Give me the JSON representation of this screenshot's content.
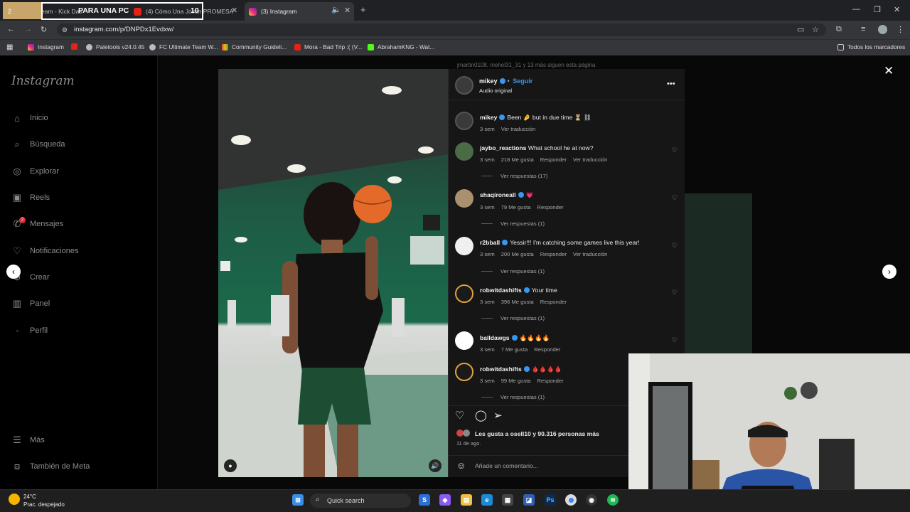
{
  "browser": {
    "tabs": [
      {
        "label": "eam - Kick Das"
      },
      {
        "label": "(4) Cómo Una Joven PROMESA"
      },
      {
        "label": "(3) Instagram",
        "active": true
      }
    ],
    "overlay": {
      "num_left": "2",
      "text": "PARA UNA PC",
      "num_right": "10"
    },
    "url": "instagram.com/p/DNPDx1Evdxw/",
    "bookmarks": [
      "Instagram",
      "Paletools v24.0.45",
      "FC Ultimate Team W...",
      "Community Guideli...",
      "Mora - Bad Trip :( (V...",
      "AbrahamKNG - Wat..."
    ],
    "all_bookmarks": "Todos los marcadores"
  },
  "sidebar": {
    "brand": "Instagram",
    "items": [
      {
        "label": "Inicio",
        "icon": "home-icon"
      },
      {
        "label": "Búsqueda",
        "icon": "search-icon"
      },
      {
        "label": "Explorar",
        "icon": "compass-icon"
      },
      {
        "label": "Reels",
        "icon": "reels-icon"
      },
      {
        "label": "Mensajes",
        "icon": "messenger-icon"
      },
      {
        "label": "Notificaciones",
        "icon": "heart-icon"
      },
      {
        "label": "Crear",
        "icon": "plus-icon"
      },
      {
        "label": "Panel",
        "icon": "panel-icon"
      },
      {
        "label": "Perfil",
        "icon": "avatar-icon"
      }
    ],
    "more": "Más",
    "meta": "También de Meta",
    "messages_badge": "2"
  },
  "background": {
    "suggestion": "jmartin0108, mehel31_31 y 13 más siguen esta página"
  },
  "post": {
    "author": "mikey",
    "follow": "Seguir",
    "audio": "Audio original",
    "caption": {
      "text": "Been 🤌 but in due time ⏳ ⛓",
      "time": "3 sem",
      "translate": "Ver traducción"
    },
    "comments": [
      {
        "user": "jaybo_reactions",
        "verified": false,
        "text": "What school he at now?",
        "time": "3 sem",
        "likes": "218 Me gusta",
        "reply": "Responder",
        "translate": "Ver traducción",
        "replies": "Ver respuestas (17)"
      },
      {
        "user": "shaqironeall",
        "verified": true,
        "text": "💗",
        "time": "3 sem",
        "likes": "79 Me gusta",
        "reply": "Responder",
        "translate": "",
        "replies": "Ver respuestas (1)"
      },
      {
        "user": "r2bball",
        "verified": true,
        "text": "Yessir!!! I'm catching some games live this year!",
        "time": "3 sem",
        "likes": "200 Me gusta",
        "reply": "Responder",
        "translate": "Ver traducción",
        "replies": "Ver respuestas (1)"
      },
      {
        "user": "robwitdashifts",
        "verified": true,
        "text": "Your time",
        "time": "3 sem",
        "likes": "396 Me gusta",
        "reply": "Responder",
        "translate": "",
        "replies": "Ver respuestas (1)"
      },
      {
        "user": "balldawgs",
        "verified": true,
        "text": "🔥🔥🔥🔥",
        "time": "3 sem",
        "likes": "7 Me gusta",
        "reply": "Responder",
        "translate": "",
        "replies": ""
      },
      {
        "user": "robwitdashifts",
        "verified": true,
        "text": "🩸🩸🩸🩸",
        "time": "3 sem",
        "likes": "99 Me gusta",
        "reply": "Responder",
        "translate": "",
        "replies": "Ver respuestas (1)"
      }
    ],
    "likes_text": "Les gusta a osell10 y 90.316 personas más",
    "date": "11 de ago.",
    "add_comment_placeholder": "Añade un comentario..."
  },
  "taskbar": {
    "temp": "24°C",
    "weather": "Prac. despejado",
    "search": "Quick search"
  },
  "colors": {
    "accent": "#3897f0",
    "verified": "#3897f0",
    "panel": "#161616",
    "court_green": "#1f6b4e"
  }
}
